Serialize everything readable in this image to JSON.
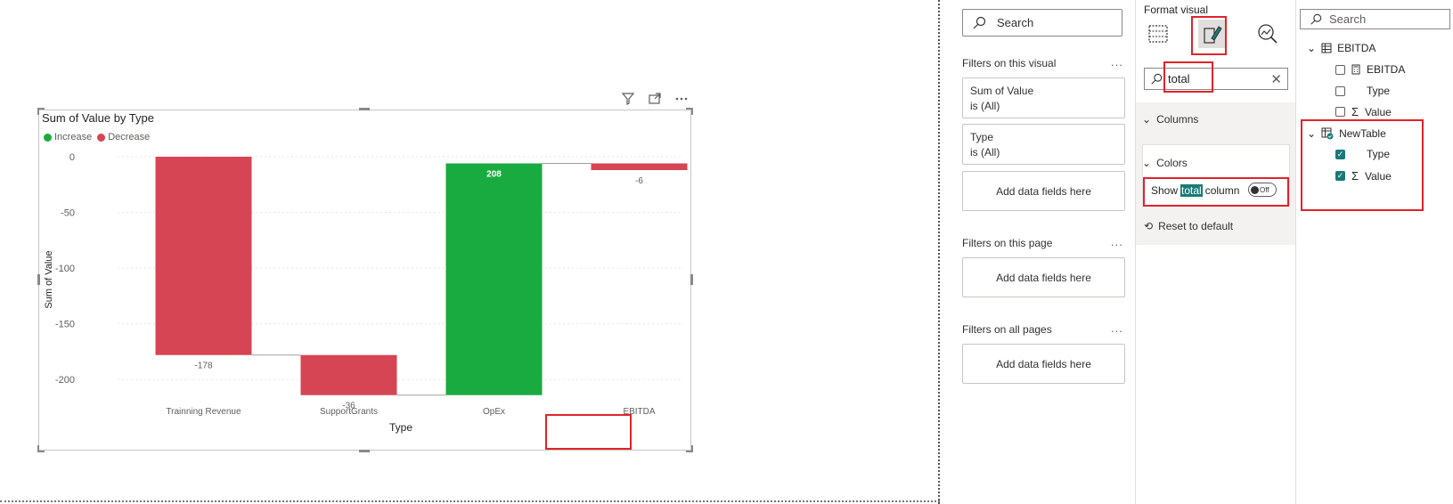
{
  "visual_header": {
    "filter_icon": "filter-icon",
    "focus_icon": "focus-mode-icon",
    "more_icon": "more-options-icon"
  },
  "chart_data": {
    "type": "waterfall",
    "title": "Sum of Value by Type",
    "xlabel": "Type",
    "ylabel": "Sum of Value",
    "categories": [
      "Trainning Revenue",
      "SupportGrants",
      "OpEx",
      "EBITDA"
    ],
    "values": [
      -178,
      -36,
      208,
      -6
    ],
    "data_labels": [
      "-178",
      "-36",
      "208",
      "-6"
    ],
    "legend": [
      {
        "name": "Increase",
        "color": "#1aab40"
      },
      {
        "name": "Decrease",
        "color": "#d64554"
      }
    ],
    "y_ticks": [
      "0",
      "-50",
      "-100",
      "-150",
      "-200"
    ],
    "ylim": [
      -215,
      0
    ],
    "grid": true
  },
  "filters": {
    "search_placeholder": "Search",
    "on_visual_title": "Filters on this visual",
    "more": "...",
    "cards": [
      {
        "line1": "Sum of Value",
        "line2": "is (All)"
      },
      {
        "line1": "Type",
        "line2": "is (All)"
      }
    ],
    "add_label": "Add data fields here",
    "on_page_title": "Filters on this page",
    "all_pages_title": "Filters on all pages"
  },
  "format": {
    "title": "Format visual",
    "search_value": "total",
    "columns_label": "Columns",
    "colors_label": "Colors",
    "show_pre": "Show",
    "show_hl": "total",
    "show_post": "column",
    "toggle_state": "Off",
    "reset_label": "Reset to default"
  },
  "data_pane": {
    "search_placeholder": "Search",
    "tables": [
      {
        "name": "EBITDA",
        "fields": [
          {
            "name": "EBITDA",
            "checked": false
          },
          {
            "name": "Type",
            "checked": false
          },
          {
            "name": "Value",
            "checked": false
          }
        ]
      },
      {
        "name": "NewTable",
        "fields": [
          {
            "name": "Type",
            "checked": true
          },
          {
            "name": "Value",
            "checked": true
          }
        ]
      }
    ]
  }
}
